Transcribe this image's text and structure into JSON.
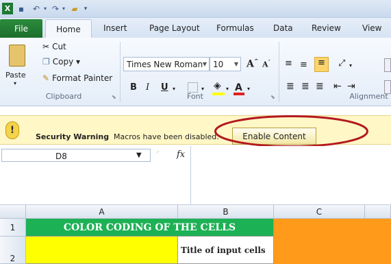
{
  "tabs": [
    "File",
    "Home",
    "Insert",
    "Page Layout",
    "Formulas",
    "Data",
    "Review",
    "View"
  ],
  "clipboard": {
    "paste": "Paste",
    "cut": "Cut",
    "copy": "Copy ▾",
    "format_painter": "Format Painter",
    "label": "Clipboard"
  },
  "font": {
    "name": "Times New Roman",
    "size": "10",
    "label": "Font"
  },
  "alignment": {
    "label": "Alignment"
  },
  "security": {
    "title": "Security Warning",
    "message": "Macros have been disabled.",
    "button": "Enable Content"
  },
  "formula_bar": {
    "name_box": "D8",
    "fx": "fx"
  },
  "columns": [
    "A",
    "B",
    "C"
  ],
  "rows": [
    "1",
    "2"
  ],
  "cells": {
    "header": "COLOR CODING OF THE CELLS",
    "title_input": "Title of input cells"
  },
  "colors": {
    "file_tab": "#1d6e2c",
    "highlight_ellipse": "#b3191f",
    "header_green": "#1db155",
    "yellow": "#ffff00",
    "orange": "#ff9a1a"
  }
}
